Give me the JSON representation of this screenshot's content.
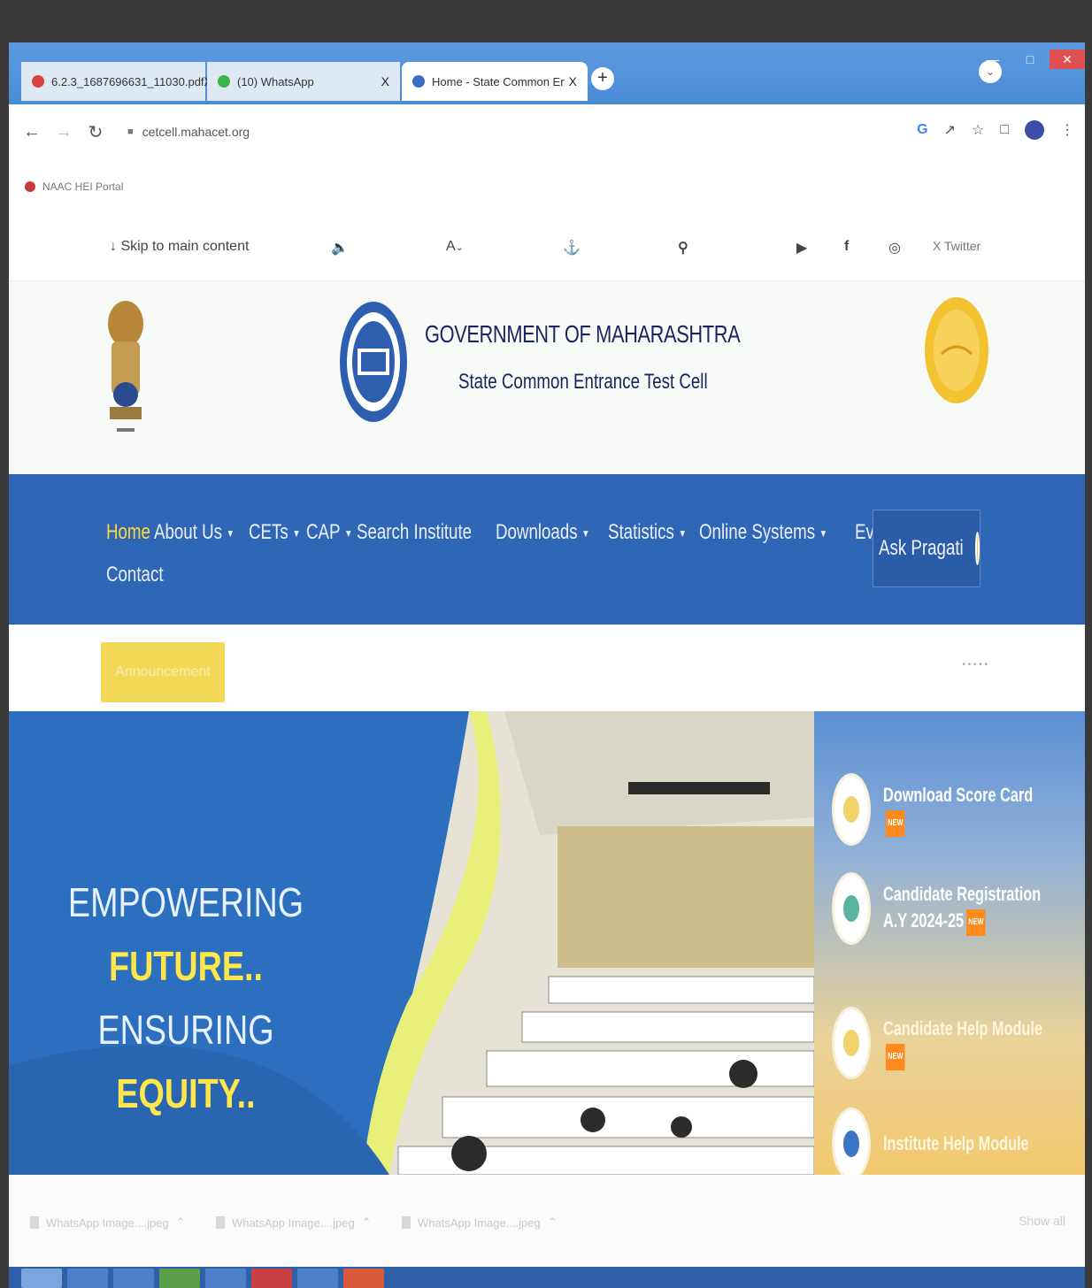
{
  "browser": {
    "tabs": [
      {
        "title": "6.2.3_1687696631_11030.pdf",
        "favicon_color": "#d94040"
      },
      {
        "title": "(10) WhatsApp",
        "favicon_color": "#3bb44a"
      },
      {
        "title": "Home - State Common Entranc",
        "favicon_color": "#3a6ec2"
      }
    ],
    "close_glyph": "X",
    "new_tab_glyph": "+",
    "url": "cetcell.mahacet.org",
    "bookmark": "NAAC HEI Portal"
  },
  "a11y_bar": {
    "skip": "Skip to main content",
    "font_size": "A",
    "twitter": "Twitter"
  },
  "header": {
    "title": "GOVERNMENT OF MAHARASHTRA",
    "subtitle": "State Common Entrance Test Cell"
  },
  "nav": {
    "items": [
      {
        "label": "Home",
        "dropdown": false
      },
      {
        "label": "About Us",
        "dropdown": true
      },
      {
        "label": "CETs",
        "dropdown": true
      },
      {
        "label": "CAP",
        "dropdown": true
      },
      {
        "label": "Search Institute",
        "dropdown": false
      },
      {
        "label": "Downloads",
        "dropdown": true
      },
      {
        "label": "Statistics",
        "dropdown": true
      },
      {
        "label": "Online Systems",
        "dropdown": true
      },
      {
        "label": "Events",
        "dropdown": false
      }
    ],
    "row2": "Contact",
    "ask": "Ask Pragati"
  },
  "announcement": {
    "button": "Announcement"
  },
  "hero": {
    "line1": "EMPOWERING",
    "line2": "FUTURE..",
    "line3_a": "ENSURING ",
    "line3_b": "EQUITY.."
  },
  "quick_links": [
    {
      "label": "Download Score Card",
      "badge": "NEW"
    },
    {
      "label": "Candidate Registration A.Y 2024-25",
      "badge": "NEW"
    },
    {
      "label": "Candidate Help Module",
      "badge": "NEW"
    },
    {
      "label": "Institute Help Module",
      "badge": ""
    }
  ],
  "downloads_bar": {
    "files": [
      "WhatsApp Image....jpeg",
      "WhatsApp Image....jpeg",
      "WhatsApp Image....jpeg"
    ],
    "show_all": "Show all"
  },
  "colors": {
    "nav_bg": "#2f66b5",
    "accent_yellow": "#ffd93b",
    "title_navy": "#1c2560"
  }
}
